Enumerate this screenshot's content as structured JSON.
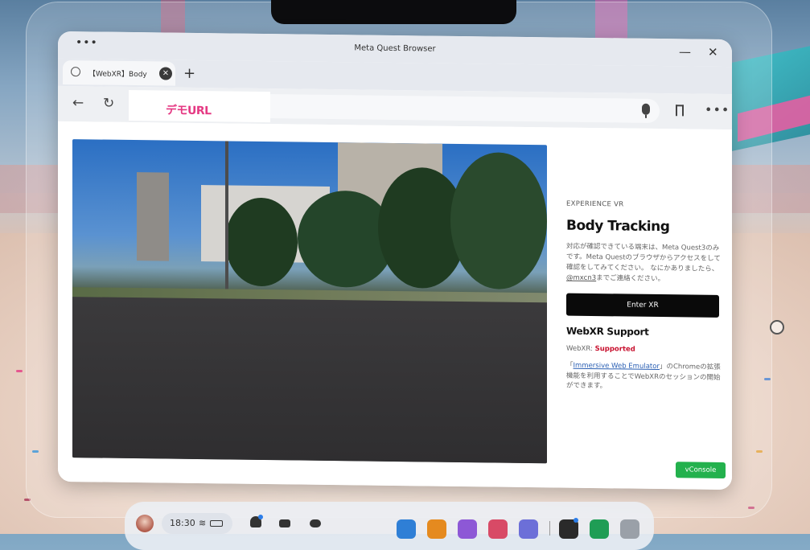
{
  "browser": {
    "window_title": "Meta Quest Browser",
    "menu_dots": "•••",
    "minimize_glyph": "—",
    "close_glyph": "✕",
    "tab": {
      "title": "【WebXR】Body",
      "close_glyph": "×"
    },
    "new_tab_glyph": "+",
    "back_glyph": "←",
    "reload_glyph": "↻",
    "url_overlay_label": "デモURL",
    "more_glyph": "•••"
  },
  "page": {
    "eyebrow": "EXPERIENCE VR",
    "heading": "Body Tracking",
    "description_before": "対応が確認できている端末は、Meta Quest3のみです。Meta Questのブラウザからアクセスをして確認をしてみてください。 なにかありましたら、",
    "description_link": "@mxcn3",
    "description_after": "までご連絡ください。",
    "enter_button": "Enter XR",
    "support_heading": "WebXR Support",
    "support_label": "WebXR: ",
    "support_value": "Supported",
    "note_before": "「",
    "note_link": "Immersive Web Emulator",
    "note_after": "」のChromeの拡張機能を利用することでWebXRのセッションの開始ができます。",
    "vconsole": "vConsole"
  },
  "taskbar": {
    "time": "18:30",
    "wifi_glyph": "≋"
  },
  "colors": {
    "accent_pink": "#e53983",
    "supported_red": "#c8102e",
    "vconsole_green": "#23b14d",
    "button_black": "#0a0a0a"
  },
  "icons": [
    "globe-icon",
    "close-icon",
    "plus-icon",
    "back-arrow-icon",
    "reload-icon",
    "microphone-icon",
    "bookmark-icon",
    "more-icon",
    "wifi-icon",
    "battery-icon",
    "bell-icon",
    "tv-icon",
    "headset-icon"
  ]
}
